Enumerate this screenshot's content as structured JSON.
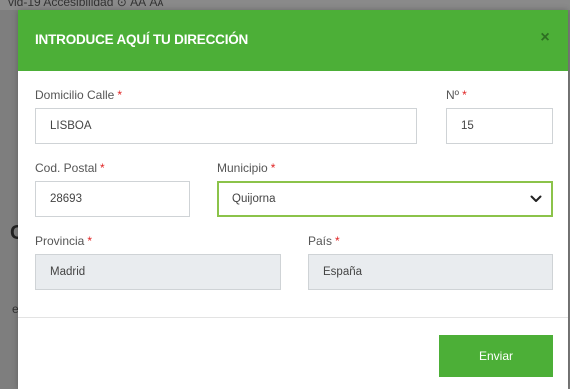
{
  "background": {
    "top_text": "vid-19     Accesibilidad  ⊙ АА Aᴀ",
    "left_letter": "C",
    "left_letter_small": "e"
  },
  "modal": {
    "title": "INTRODUCE AQUÍ TU DIRECCIÓN",
    "close_symbol": "×",
    "fields": {
      "street": {
        "label": "Domicilio Calle",
        "value": "LISBOA"
      },
      "number": {
        "label": "Nº",
        "value": "15"
      },
      "postal_code": {
        "label": "Cod. Postal",
        "value": "28693"
      },
      "municipality": {
        "label": "Municipio",
        "value": "Quijorna"
      },
      "province": {
        "label": "Provincia",
        "value": "Madrid"
      },
      "country": {
        "label": "País",
        "value": "España"
      }
    },
    "required_mark": "*",
    "submit_label": "Enviar"
  },
  "colors": {
    "accent": "#4caf37",
    "select_border": "#8bc34a",
    "required": "#e02424"
  }
}
